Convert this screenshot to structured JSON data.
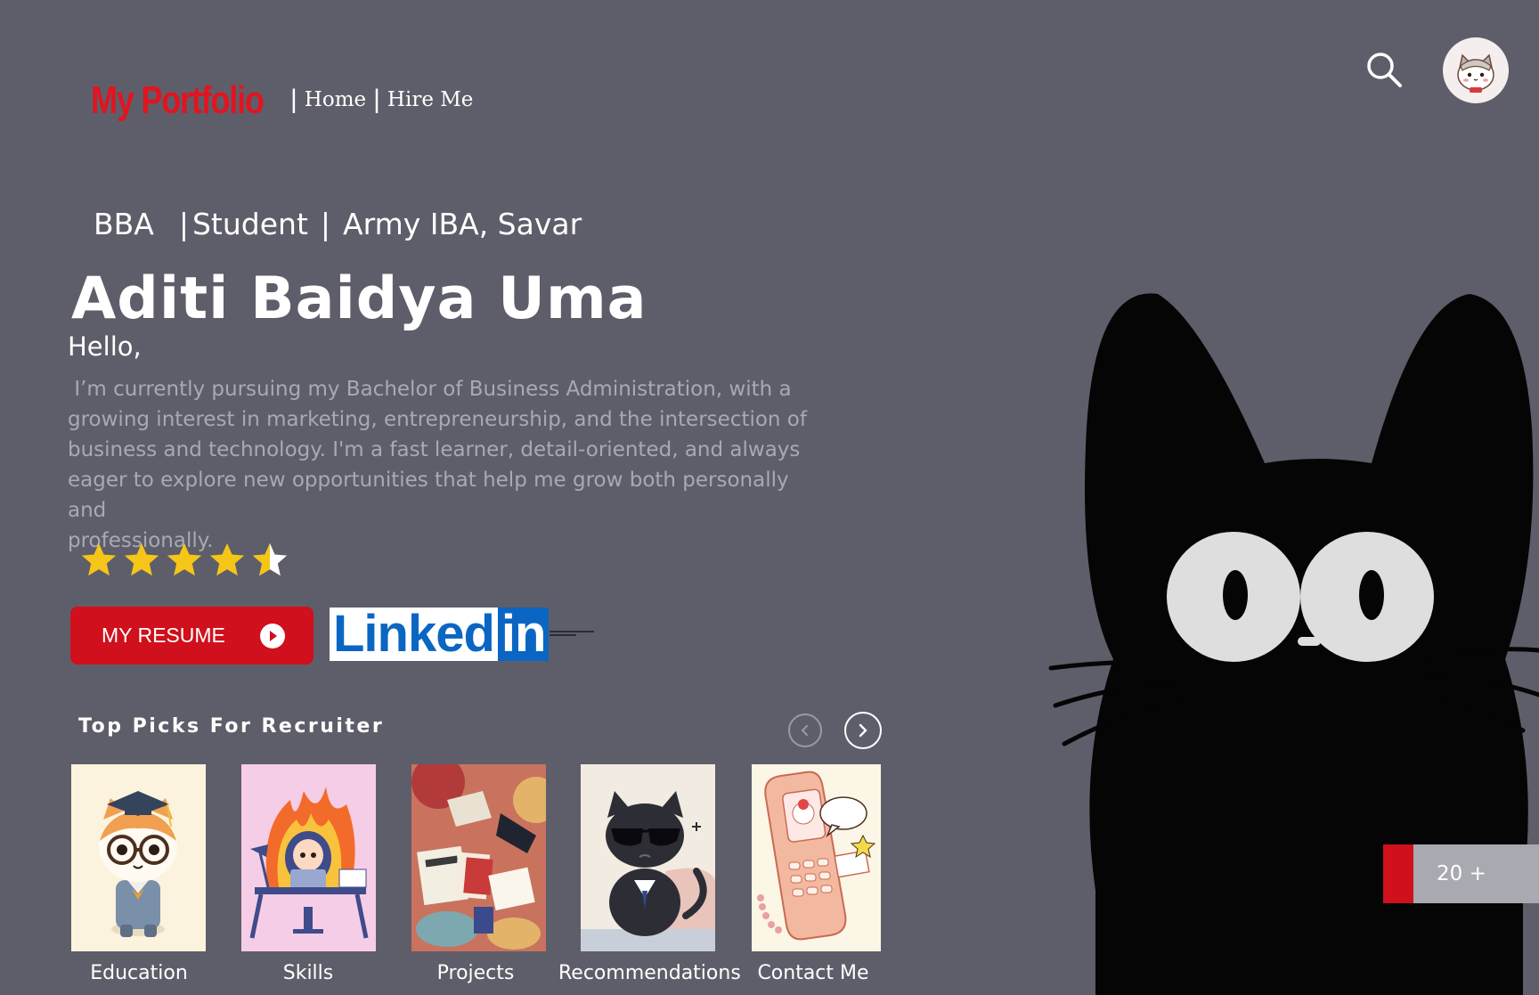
{
  "header": {
    "brand": "My Portfolio",
    "nav": [
      {
        "label": "Home"
      },
      {
        "label": "Hire Me"
      }
    ],
    "separator": "|"
  },
  "hero": {
    "subtitle": {
      "degree": "BBA",
      "role": "Student",
      "institution": "Army IBA, Savar"
    },
    "name": "Aditi Baidya Uma",
    "greeting": "Hello,",
    "bio": " I’m currently pursuing my Bachelor of Business Administration, with a\ngrowing interest in marketing, entrepreneurship, and the intersection of\nbusiness and technology. I'm a fast learner, detail-oriented, and always\neager to explore new opportunities that help me grow both personally and\nprofessionally.",
    "rating": 4.5,
    "rating_max": 5
  },
  "actions": {
    "resume_label": "MY RESUME",
    "linkedin_word": "Linked",
    "linkedin_in": "in"
  },
  "picks": {
    "title": "Top Picks For Recruiter",
    "cards": [
      {
        "label": "Education",
        "icon": "graduate-cat-icon"
      },
      {
        "label": "Skills",
        "icon": "working-girl-icon"
      },
      {
        "label": "Projects",
        "icon": "study-desk-icon"
      },
      {
        "label": "Recommendations",
        "icon": "cool-cat-icon"
      },
      {
        "label": "Contact Me",
        "icon": "phone-icon"
      }
    ]
  },
  "counter": {
    "label": "20 +"
  },
  "colors": {
    "background": "#5e5e6a",
    "accent_red": "#d0101c",
    "linkedin_blue": "#0a66c2",
    "star": "#f5c518"
  }
}
